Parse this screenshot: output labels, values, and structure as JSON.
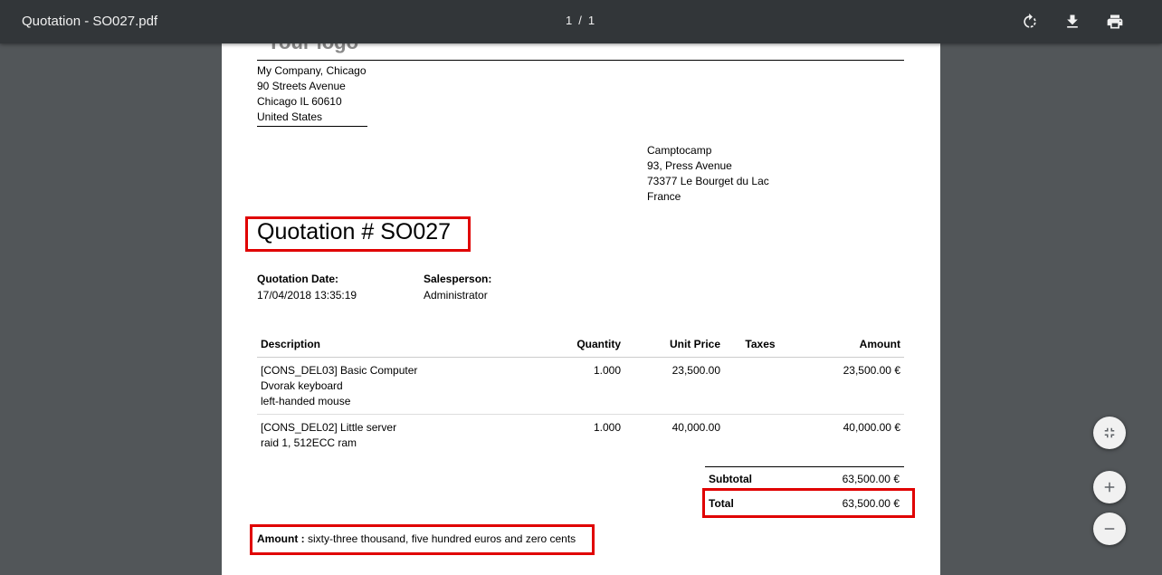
{
  "toolbar": {
    "title": "Quotation - SO027.pdf",
    "current_page": "1",
    "separator": "/",
    "total_pages": "1",
    "icons": [
      "rotate-icon",
      "download-icon",
      "print-icon"
    ]
  },
  "document": {
    "logo_text": "Your logo",
    "company": [
      "My Company, Chicago",
      "90 Streets Avenue",
      "Chicago IL 60610",
      "United States"
    ],
    "customer": [
      "Camptocamp",
      "93, Press Avenue",
      "73377 Le Bourget du Lac",
      "France"
    ],
    "title": "Quotation # SO027",
    "info": {
      "date_label": "Quotation Date:",
      "date_value": "17/04/2018 13:35:19",
      "salesperson_label": "Salesperson:",
      "salesperson_value": "Administrator"
    },
    "table": {
      "headers": [
        "Description",
        "Quantity",
        "Unit Price",
        "Taxes",
        "Amount"
      ],
      "rows": [
        {
          "description": [
            "[CONS_DEL03] Basic Computer",
            "Dvorak keyboard",
            "left-handed mouse"
          ],
          "quantity": "1.000",
          "unit_price": "23,500.00",
          "taxes": "",
          "amount": "23,500.00 €"
        },
        {
          "description": [
            "[CONS_DEL02] Little server",
            "raid 1, 512ECC ram"
          ],
          "quantity": "1.000",
          "unit_price": "40,000.00",
          "taxes": "",
          "amount": "40,000.00 €"
        }
      ]
    },
    "totals": {
      "subtotal_label": "Subtotal",
      "subtotal_value": "63,500.00 €",
      "total_label": "Total",
      "total_value": "63,500.00 €"
    },
    "amount_words": {
      "label": "Amount :",
      "value": "sixty-three thousand, five hundred euros and zero cents"
    }
  },
  "zoom_controls": [
    "fit-page-icon",
    "zoom-in-icon",
    "zoom-out-icon"
  ],
  "colors": {
    "toolbar": "#323639",
    "viewer_bg": "#525659",
    "highlight": "#e00000"
  }
}
